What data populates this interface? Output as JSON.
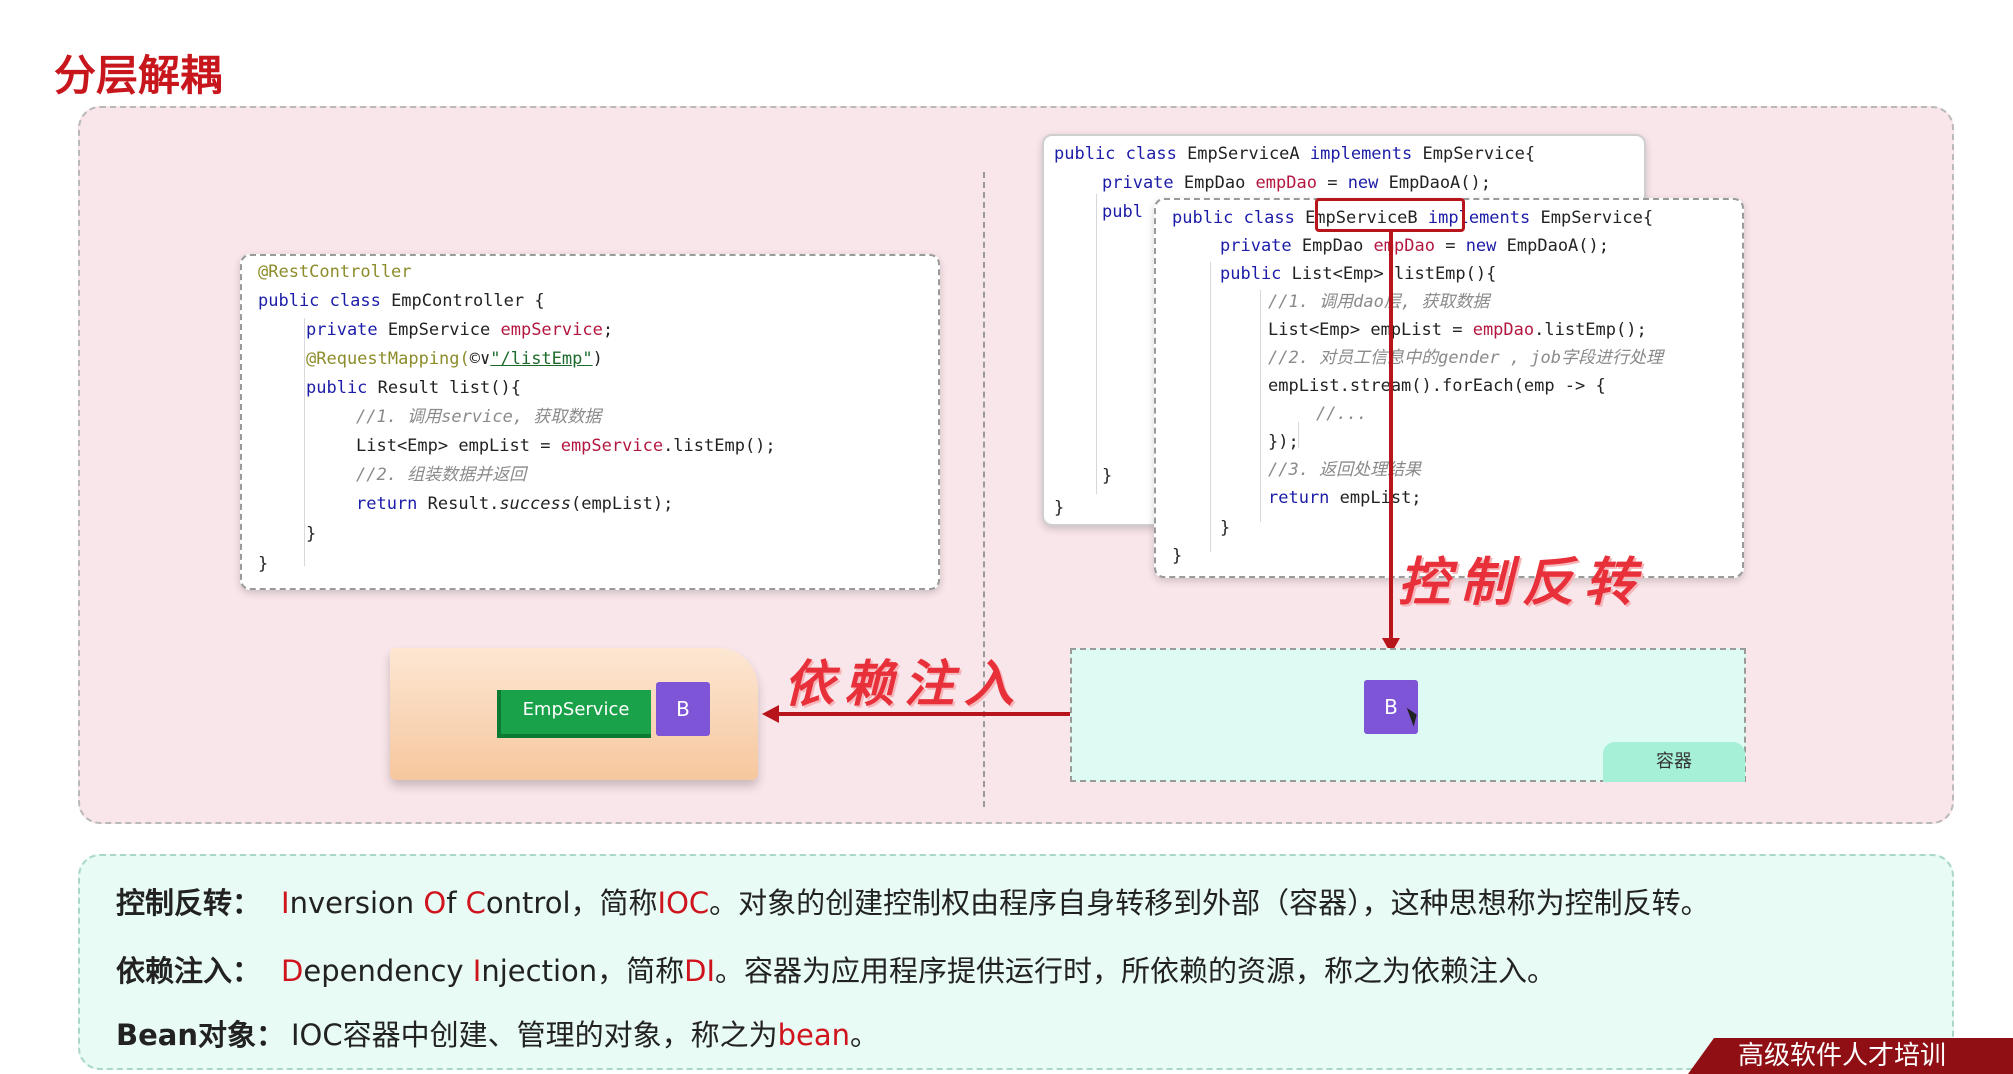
{
  "title": "分层解耦",
  "controller_code": {
    "l1": "@RestController",
    "l2_kw": "public class ",
    "l2_rest": "EmpController {",
    "l3_kw": "private ",
    "l3_type": "EmpService ",
    "l3_field": "empService",
    "l3_end": ";",
    "l4_ann": "@RequestMapping(",
    "l4_icon": "©∨",
    "l4_str": "\"/listEmp\"",
    "l4_end": ")",
    "l5_kw": "public ",
    "l5_rest": "Result list(){",
    "l6": "//1. 调用service, 获取数据",
    "l7_a": "List<Emp> empList = ",
    "l7_field": "empService",
    "l7_b": ".listEmp();",
    "l8": "//2. 组装数据并返回",
    "l9_kw": "return ",
    "l9_a": "Result.",
    "l9_ital": "success",
    "l9_b": "(empList);",
    "l10": "}",
    "l11": "}"
  },
  "service_a_code": {
    "l1_kw": "public class ",
    "l1_name": "EmpServiceA ",
    "l1_kw2": "implements ",
    "l1_rest": "EmpService{",
    "l2_kw": "private ",
    "l2_type": "EmpDao ",
    "l2_field": "empDao",
    "l2_eq": " = ",
    "l2_kw2": "new ",
    "l2_rest": "EmpDaoA();",
    "l3": "publ",
    "l4": "}",
    "l5": "}"
  },
  "service_b_code": {
    "l1_kw": "public class ",
    "l1_name": "EmpServiceB ",
    "l1_kw2": "implements ",
    "l1_rest": "EmpService{",
    "l2_kw": "private ",
    "l2_type": "EmpDao ",
    "l2_field": "empDao",
    "l2_eq": " = ",
    "l2_kw2": "new ",
    "l2_rest": "EmpDaoA();",
    "l3_kw": "public ",
    "l3_rest": "List<Emp> listEmp(){",
    "l4": "//1. 调用dao层, 获取数据",
    "l5_a": "List<Emp> empList = ",
    "l5_field": "empDao",
    "l5_b": ".listEmp();",
    "l6": "//2. 对员工信息中的gender , job字段进行处理",
    "l7": "empList.stream().forEach(emp -> {",
    "l8": "//...",
    "l9": "});",
    "l10": "//3. 返回处理结果",
    "l11_kw": "return ",
    "l11_rest": "empList;",
    "l12": "}",
    "l13": "}"
  },
  "labels": {
    "inversion": "控制反转",
    "injection": "依赖注入",
    "emp_service_tag": "EmpService",
    "bean_letter": "B",
    "container": "容器"
  },
  "definitions": {
    "ioc_term": "控制反转：",
    "ioc_I": "I",
    "ioc_nversion": "nversion ",
    "ioc_O": "O",
    "ioc_f": "f ",
    "ioc_C": "C",
    "ioc_ontrol": "ontrol，简称",
    "ioc_abbr": "IOC",
    "ioc_desc": "。对象的创建控制权由程序自身转移到外部（容器），这种思想称为控制反转。",
    "di_term": "依赖注入：",
    "di_D": "D",
    "di_ependency": "ependency ",
    "di_I": "I",
    "di_njection": "njection，简称",
    "di_abbr": "DI",
    "di_desc": "。容器为应用程序提供运行时，所依赖的资源，称之为依赖注入。",
    "bean_term": "Bean对象：",
    "bean_desc": "IOC容器中创建、管理的对象，称之为",
    "bean_word": "bean",
    "bean_end": "。"
  },
  "brand": "高级软件人才培训"
}
